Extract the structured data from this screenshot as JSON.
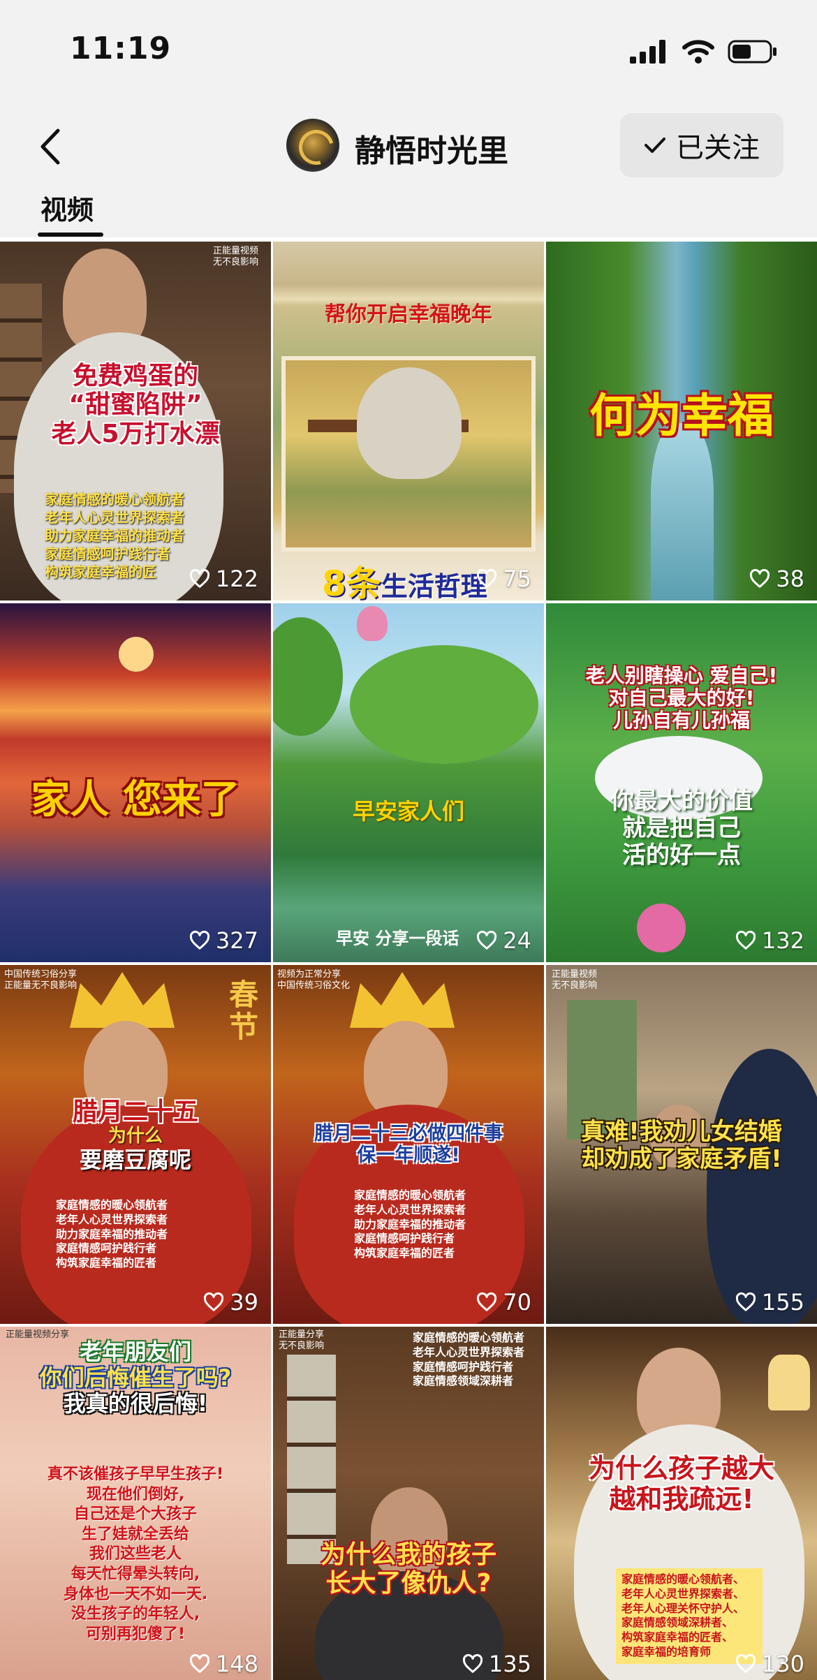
{
  "status_bar": {
    "time": "11:19"
  },
  "header": {
    "channel_name": "静悟时光里",
    "follow_label": "已关注",
    "tab_label": "视频"
  },
  "tiles": [
    {
      "title_lines": [
        "免费鸡蛋的",
        "“甜蜜陷阱”",
        "老人5万打水漂"
      ],
      "sub_lines": [
        "家庭情感的暖心领航者",
        "老年人心灵世界探索者",
        "助力家庭幸福的推动者",
        "家庭情感呵护践行者",
        "构筑家庭幸福的匠"
      ],
      "corner_lines": [
        "正能量视频",
        "无不良影响"
      ],
      "likes": "122"
    },
    {
      "title_lines": [
        "帮你开启幸福晚年"
      ],
      "bottom_caption_num": "8条",
      "bottom_caption_text": "生活哲理",
      "likes": "75"
    },
    {
      "title_lines": [
        "何为幸福"
      ],
      "likes": "38"
    },
    {
      "title_lines": [
        "家人 您来了"
      ],
      "likes": "327"
    },
    {
      "title_lines": [
        "早安家人们"
      ],
      "bottom_caption_text": "早安 分享一段话",
      "likes": "24"
    },
    {
      "title_lines": [
        "老人别瞎操心 爱自己!",
        "对自己最大的好!",
        "儿孙自有儿孙福"
      ],
      "sub_lines": [
        "你最大的价值",
        "就是把自己",
        "活的好一点"
      ],
      "likes": "132"
    },
    {
      "title_lines": [
        "腊月二十五",
        "为什么",
        "要磨豆腐呢"
      ],
      "sub_lines": [
        "家庭情感的暖心领航者",
        "老年人心灵世界探索者",
        "助力家庭幸福的推动者",
        "家庭情感呵护践行者",
        "构筑家庭幸福的匠者"
      ],
      "corner_lines": [
        "中国传统习俗分享",
        "正能量无不良影响"
      ],
      "side_text": "春节",
      "likes": "39"
    },
    {
      "title_lines": [
        "腊月二十三必做四件事",
        "保一年顺遂!"
      ],
      "sub_lines": [
        "家庭情感的暖心领航者",
        "老年人心灵世界探索者",
        "助力家庭幸福的推动者",
        "家庭情感呵护践行者",
        "构筑家庭幸福的匠者"
      ],
      "corner_lines": [
        "视频为正常分享",
        "中国传统习俗文化"
      ],
      "likes": "70"
    },
    {
      "title_lines": [
        "真难!我劝儿女结婚",
        "却劝成了家庭矛盾!"
      ],
      "corner_lines": [
        "正能量视频",
        "无不良影响"
      ],
      "likes": "155"
    },
    {
      "title_lines": [
        "老年朋友们",
        "你们后悔催生了吗?",
        "我真的很后悔!"
      ],
      "sub_lines": [
        "真不该催孩子早早生孩子!",
        "现在他们倒好,",
        "自己还是个大孩子",
        "生了娃就全丢给",
        "我们这些老人",
        "每天忙得晕头转向,",
        "身体也一天不如一天.",
        "没生孩子的年轻人,",
        "可别再犯傻了!"
      ],
      "corner_lines": [
        "正能量视频分享"
      ],
      "likes": "148"
    },
    {
      "title_lines": [
        "为什么我的孩子",
        "长大了像仇人?"
      ],
      "sub_lines": [
        "家庭情感的暖心领航者",
        "老年人心灵世界探索者",
        "家庭情感呵护践行者",
        "家庭情感领域深耕者"
      ],
      "corner_lines": [
        "正能量分享",
        "无不良影响"
      ],
      "likes": "135"
    },
    {
      "title_lines": [
        "为什么孩子越大",
        "越和我疏远!"
      ],
      "sub_lines": [
        "家庭情感的暖心领航者、",
        "老年人心灵世界探索者、",
        "老年人心理关怀守护人、",
        "家庭情感领域深耕者、",
        "构筑家庭幸福的匠者、",
        "家庭幸福的培育师"
      ],
      "likes": "130"
    }
  ]
}
